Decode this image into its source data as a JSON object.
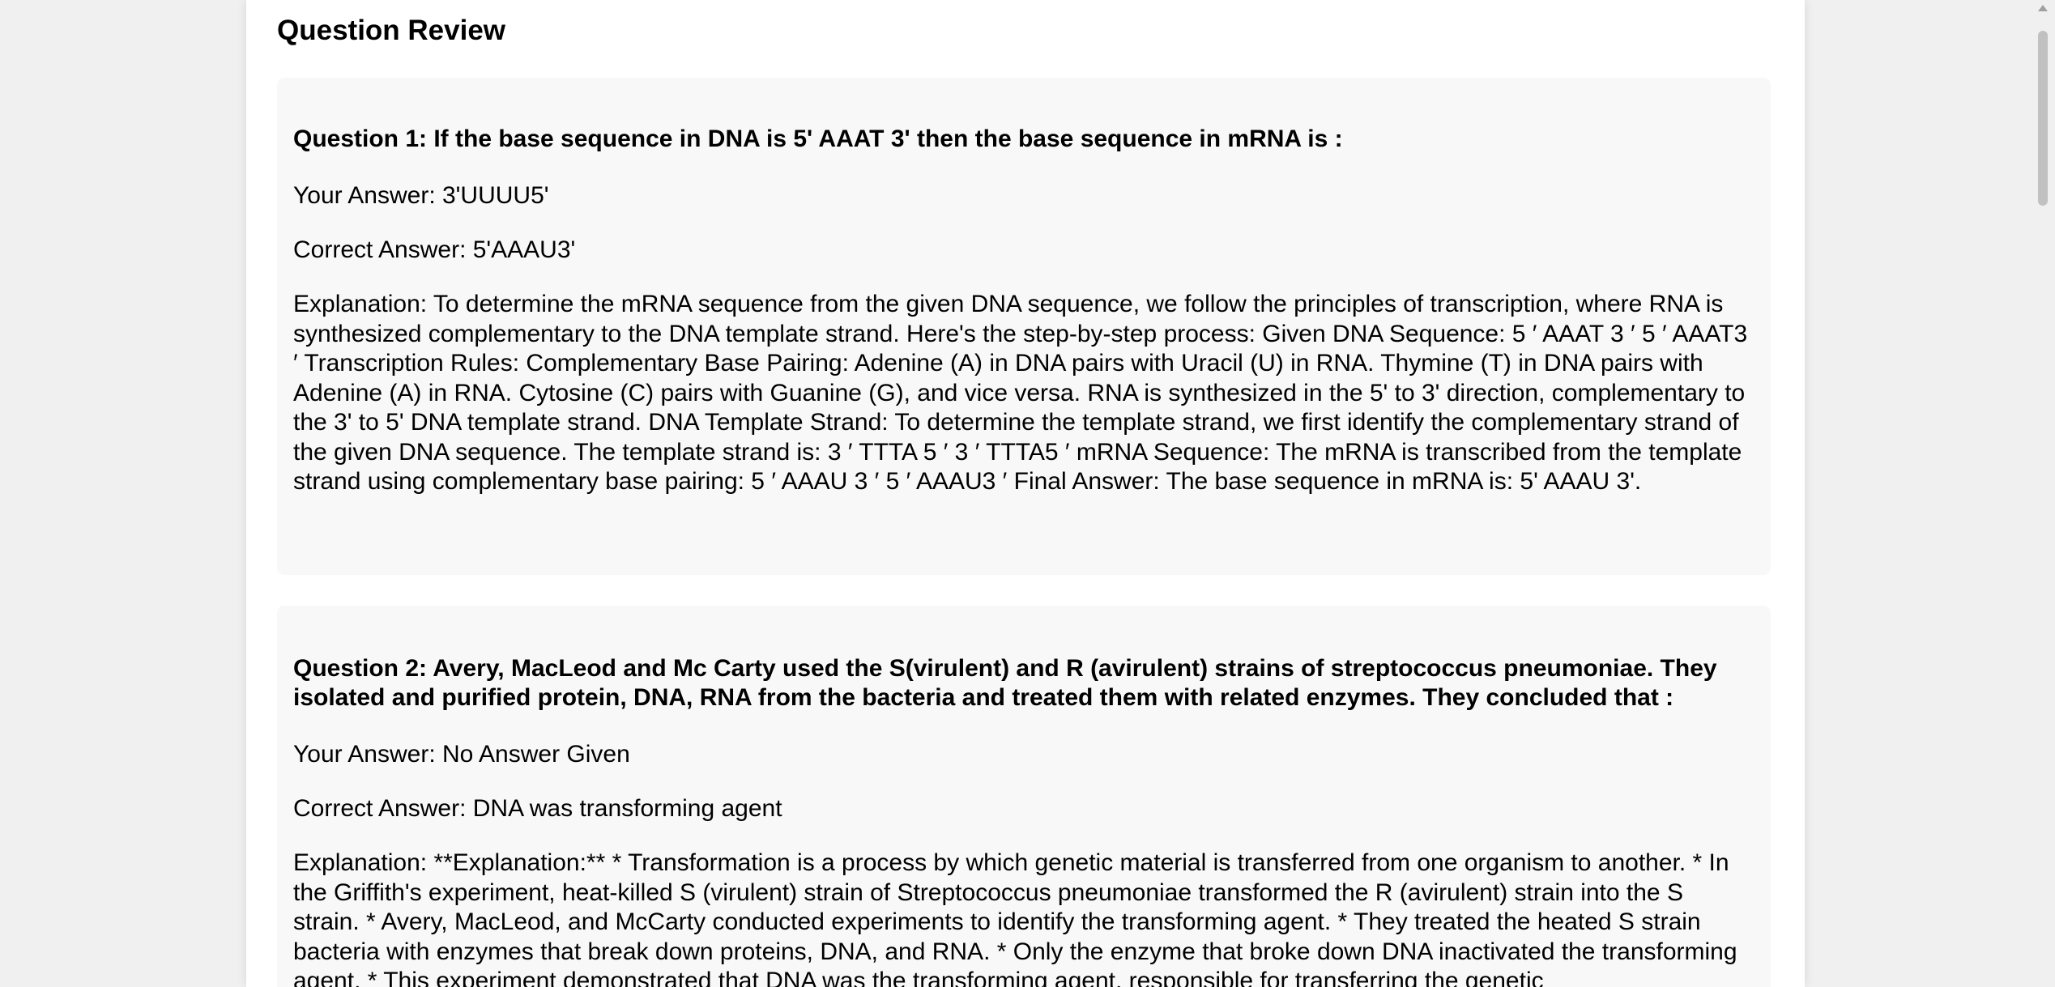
{
  "page": {
    "title": "Question Review"
  },
  "questions": [
    {
      "label": "Question 1: If the base sequence in DNA is 5' AAAT 3' then the base sequence in mRNA is :",
      "your_answer": "Your Answer: 3'UUUU5'",
      "correct_answer": "Correct Answer: 5'AAAU3'",
      "explanation": "Explanation: To determine the mRNA sequence from the given DNA sequence, we follow the principles of transcription, where RNA is synthesized complementary to the DNA template strand. Here's the step-by-step process: Given DNA Sequence: 5 ′  AAAT  3 ′ 5 ′ AAAT3 ′ Transcription Rules: Complementary Base Pairing: Adenine (A) in DNA pairs with Uracil (U) in RNA. Thymine (T) in DNA pairs with Adenine (A) in RNA. Cytosine (C) pairs with Guanine (G), and vice versa. RNA is synthesized in the 5' to 3' direction, complementary to the 3' to 5' DNA template strand. DNA Template Strand: To determine the template strand, we first identify the complementary strand of the given DNA sequence. The template strand is: 3 ′  TTTA  5 ′ 3 ′ TTTA5 ′ mRNA Sequence: The mRNA is transcribed from the template strand using complementary base pairing: 5 ′  AAAU  3 ′ 5 ′ AAAU3 ′ Final Answer: The base sequence in mRNA is: 5' AAAU 3'."
    },
    {
      "label": "Question 2: Avery, MacLeod and Mc Carty used the S(virulent) and R (avirulent) strains of streptococcus pneumoniae. They isolated and purified protein, DNA, RNA from the bacteria and treated them with related enzymes. They concluded that :",
      "your_answer": "Your Answer: No Answer Given",
      "correct_answer": "Correct Answer: DNA was transforming agent",
      "explanation": "Explanation: **Explanation:** * Transformation is a process by which genetic material is transferred from one organism to another. * In the Griffith's experiment, heat-killed S (virulent) strain of Streptococcus pneumoniae transformed the R (avirulent) strain into the S strain. * Avery, MacLeod, and McCarty conducted experiments to identify the transforming agent. * They treated the heated S strain bacteria with enzymes that break down proteins, DNA, and RNA. * Only the enzyme that broke down DNA inactivated the transforming agent. * This experiment demonstrated that DNA was the transforming agent, responsible for transferring the genetic"
    }
  ]
}
